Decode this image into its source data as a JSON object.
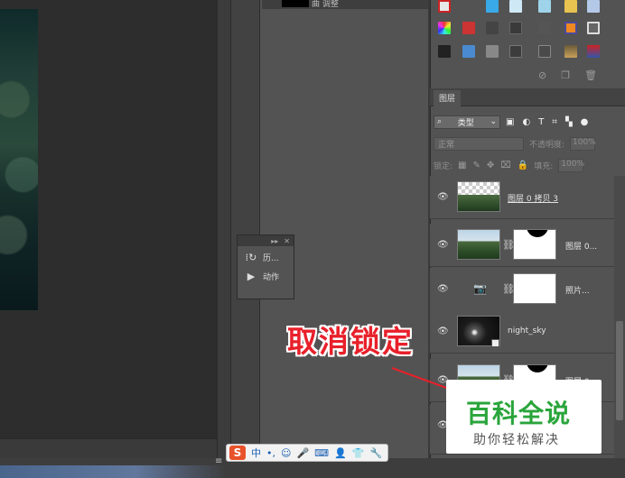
{
  "mid_panel": {
    "top_layer_label": "曲  调整"
  },
  "collapsed_panel": {
    "items": [
      {
        "label": "历...",
        "icon": "history-icon"
      },
      {
        "label": "动作",
        "icon": "actions-play-icon"
      }
    ]
  },
  "layers_panel": {
    "tab_label": "图层",
    "filter_label": "类型",
    "blend_mode": "正常",
    "opacity_label": "不透明度:",
    "opacity_value": "100%",
    "lock_label": "锁定:",
    "fill_label": "填充:",
    "fill_value": "100%",
    "layers": [
      {
        "name": "图层 0 拷贝 3",
        "type": "landscape-checker"
      },
      {
        "name": "图层 0...",
        "type": "landscape-mask"
      },
      {
        "name": "照片...",
        "type": "adjustment-mask"
      },
      {
        "name": "night_sky",
        "type": "smart"
      },
      {
        "name": "图层 0...",
        "type": "landscape-mask"
      },
      {
        "name": "",
        "type": "partial"
      }
    ]
  },
  "ime": {
    "logo": "S",
    "mode": "中"
  },
  "annotation": {
    "text": "取消锁定"
  },
  "watermark": {
    "title": "百科全说",
    "subtitle": "助你轻松解决"
  }
}
